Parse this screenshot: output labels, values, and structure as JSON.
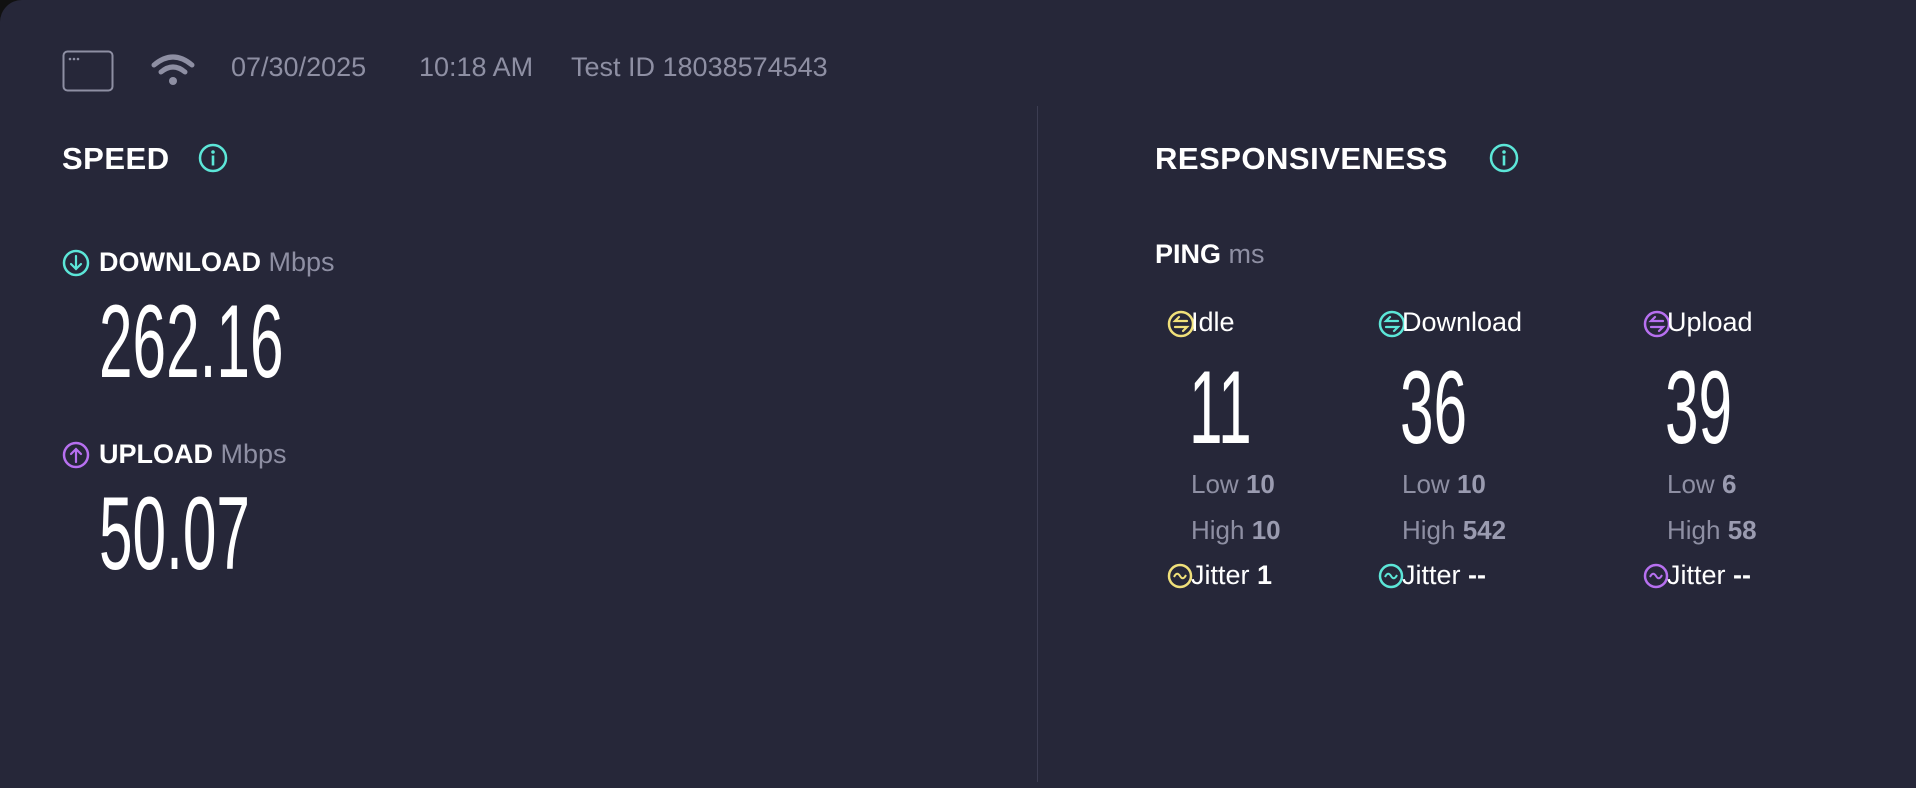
{
  "header": {
    "date": "07/30/2025",
    "time": "10:18 AM",
    "test_id": "Test ID 18038574543",
    "icons": [
      "browser-window-icon",
      "wifi-icon"
    ]
  },
  "speed": {
    "title": "SPEED",
    "download": {
      "label": "DOWNLOAD",
      "unit": "Mbps",
      "value": "262.16"
    },
    "upload": {
      "label": "UPLOAD",
      "unit": "Mbps",
      "value": "50.07"
    }
  },
  "responsiveness": {
    "title": "RESPONSIVENESS",
    "ping_label": "PING",
    "ping_unit": "ms",
    "low_label": "Low",
    "high_label": "High",
    "jitter_label": "Jitter",
    "columns": [
      {
        "label": "Idle",
        "value": "11",
        "low": "10",
        "high": "10",
        "jitter": "1",
        "color": "#f0e07a"
      },
      {
        "label": "Download",
        "value": "36",
        "low": "10",
        "high": "542",
        "jitter": "--",
        "color": "#5ce6d8"
      },
      {
        "label": "Upload",
        "value": "39",
        "low": "6",
        "high": "58",
        "jitter": "--",
        "color": "#b770f0"
      }
    ]
  },
  "colors": {
    "background": "#262739",
    "teal": "#5ce6d8",
    "purple": "#b770f0",
    "yellow": "#f0e07a",
    "muted": "#8e8fa3"
  }
}
